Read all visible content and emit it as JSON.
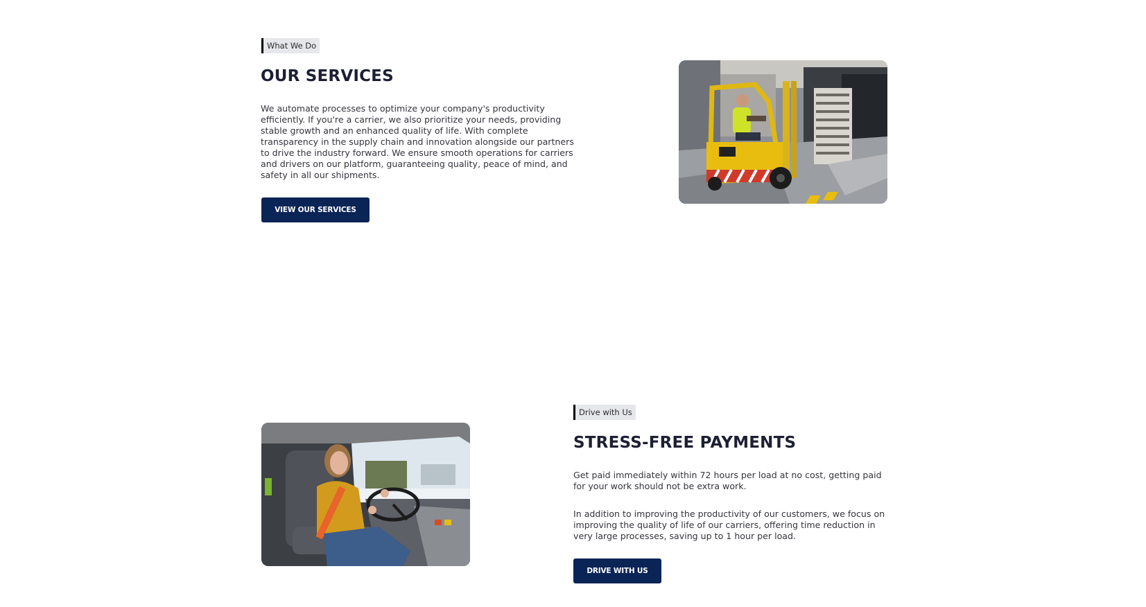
{
  "services": {
    "tag": "What We Do",
    "title": "OUR SERVICES",
    "paragraph": "We automate processes to optimize your company's productivity efficiently. If you're a carrier, we also prioritize your needs, providing stable growth and an enhanced quality of life. With complete transparency in the supply chain and innovation alongside our partners to drive the industry forward. We ensure smooth operations for carriers and drivers on our platform, guaranteeing quality, peace of mind, and safety in all our shipments.",
    "button_label": "VIEW OUR SERVICES",
    "image": "forklift-warehouse-photo"
  },
  "drive": {
    "tag": "Drive with Us",
    "title": "STRESS-FREE PAYMENTS",
    "paragraph_1": "Get paid immediately within 72 hours per load at no cost, getting paid for your work should not be extra work.",
    "paragraph_2": "In addition to improving the productivity of our customers, we focus on improving the quality of life of our carriers, offering time reduction in very large processes, saving up to 1 hour per load.",
    "button_label": "DRIVE WITH US",
    "image": "truck-driver-photo"
  },
  "colors": {
    "button": "#0b2456",
    "heading": "#1d1f33",
    "tag_background": "#e6e7ea",
    "tag_border": "#000000"
  }
}
